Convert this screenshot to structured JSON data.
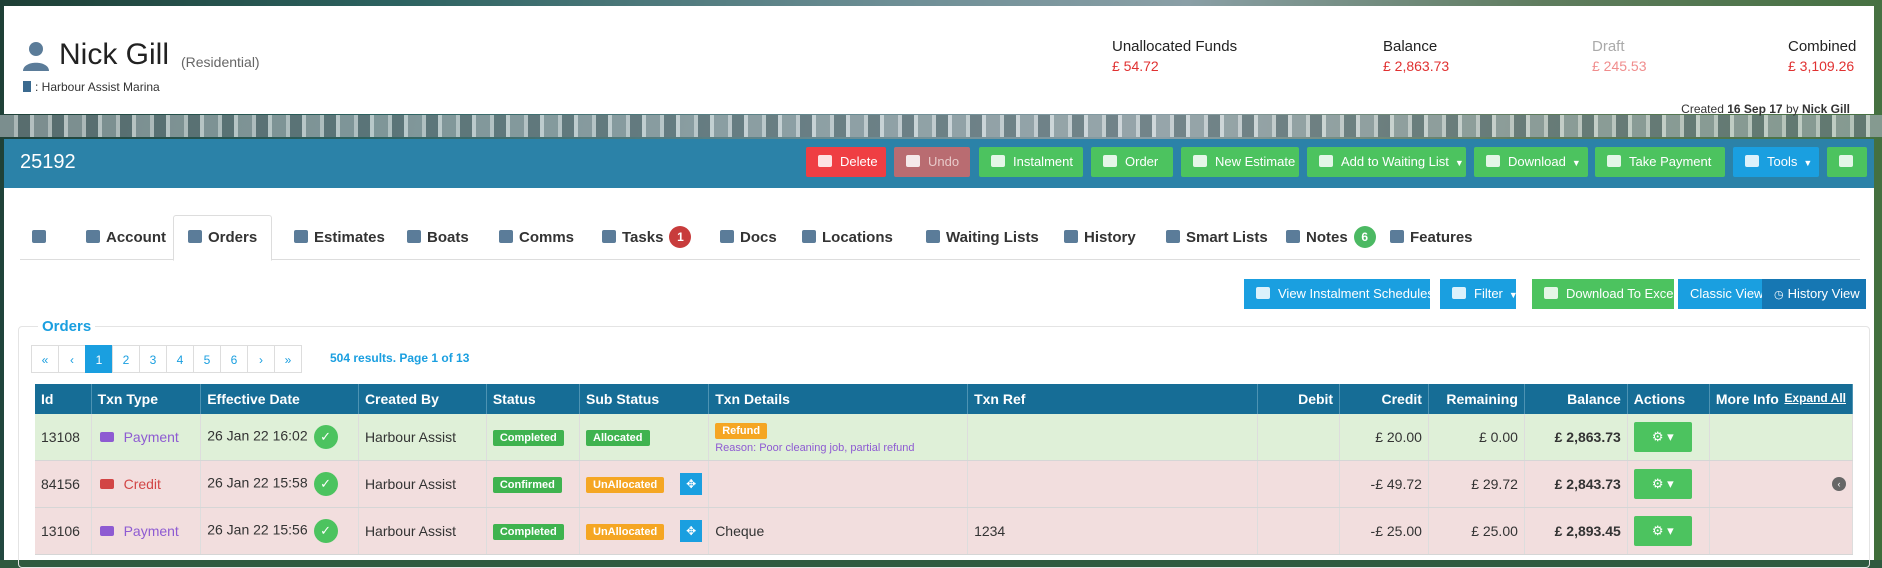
{
  "customer": {
    "name": "Nick Gill",
    "type": "(Residential)",
    "marina": ": Harbour Assist Marina",
    "created_prefix": "Created",
    "created_date": "16 Sep 17",
    "created_by_prefix": "by",
    "created_by": "Nick Gill"
  },
  "funds": [
    {
      "label": "Unallocated Funds",
      "value": "£ 54.72"
    },
    {
      "label": "Balance",
      "value": "£ 2,863.73"
    },
    {
      "label": "Draft",
      "value": "£ 245.53"
    },
    {
      "label": "Combined",
      "value": "£ 3,109.26"
    }
  ],
  "account_id": "25192",
  "toolbar": {
    "delete": "Delete",
    "undo": "Undo",
    "instalment": "Instalment",
    "order": "Order",
    "new_estimate": "New Estimate",
    "add_waiting": "Add to Waiting List",
    "download": "Download",
    "take_payment": "Take Payment",
    "tools": "Tools"
  },
  "tabs": [
    {
      "label": "Account"
    },
    {
      "label": "Orders"
    },
    {
      "label": "Estimates"
    },
    {
      "label": "Boats"
    },
    {
      "label": "Comms"
    },
    {
      "label": "Tasks",
      "badge": "1"
    },
    {
      "label": "Docs"
    },
    {
      "label": "Locations"
    },
    {
      "label": "Waiting Lists"
    },
    {
      "label": "History"
    },
    {
      "label": "Smart Lists"
    },
    {
      "label": "Notes",
      "badge": "6"
    },
    {
      "label": "Features"
    }
  ],
  "view_buttons": {
    "instalment_schedules": "View Instalment Schedules",
    "filter": "Filter",
    "excel": "Download To Excel",
    "classic": "Classic View",
    "history": "History View"
  },
  "orders": {
    "legend": "Orders",
    "pager": [
      "«",
      "‹",
      "1",
      "2",
      "3",
      "4",
      "5",
      "6",
      "›",
      "»"
    ],
    "results": "504 results. Page 1 of 13",
    "columns": [
      "Id",
      "Txn Type",
      "Effective Date",
      "Created By",
      "Status",
      "Sub Status",
      "Txn Details",
      "Txn Ref",
      "Debit",
      "Credit",
      "Remaining",
      "Balance",
      "Actions",
      "More Info"
    ],
    "expand_all": "Expand All",
    "rows": [
      {
        "id": "13108",
        "type": "Payment",
        "date": "26 Jan 22 16:02",
        "created_by": "Harbour Assist",
        "status": "Completed",
        "sub_status": "Allocated",
        "details_label": "Refund",
        "details_reason": "Reason: Poor cleaning job, partial refund",
        "ref": "",
        "debit": "",
        "credit": "£ 20.00",
        "remaining": "£ 0.00",
        "balance": "£ 2,863.73"
      },
      {
        "id": "84156",
        "type": "Credit",
        "date": "26 Jan 22 15:58",
        "created_by": "Harbour Assist",
        "status": "Confirmed",
        "sub_status": "UnAllocated",
        "details_text": "",
        "ref": "",
        "debit": "",
        "credit": "-£ 49.72",
        "remaining": "£ 29.72",
        "balance": "£ 2,843.73"
      },
      {
        "id": "13106",
        "type": "Payment",
        "date": "26 Jan 22 15:56",
        "created_by": "Harbour Assist",
        "status": "Completed",
        "sub_status": "UnAllocated",
        "details_text": "Cheque",
        "ref": "1234",
        "debit": "",
        "credit": "-£ 25.00",
        "remaining": "£ 25.00",
        "balance": "£ 2,893.45"
      }
    ]
  }
}
